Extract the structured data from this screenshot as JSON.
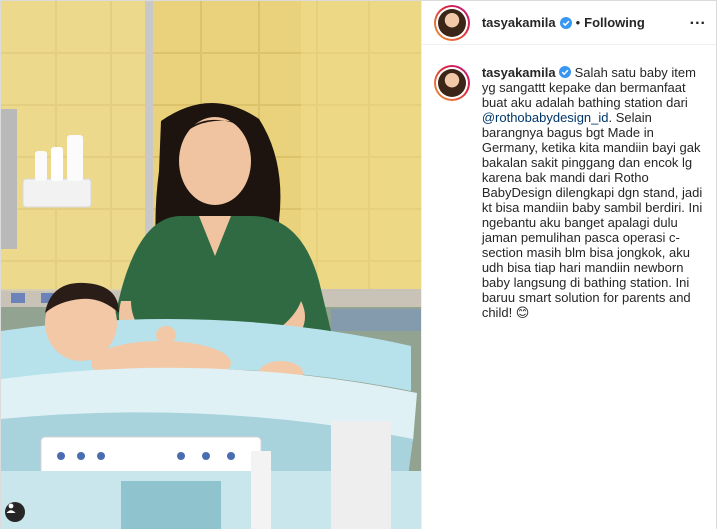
{
  "post": {
    "username": "tasyakamila",
    "follow_state": "Following",
    "separator": "•",
    "more_label": "...",
    "caption": {
      "username": "tasyakamila",
      "text_before": "Salah satu baby item yg sangattt kepake dan bermanfaat buat aku adalah bathing station dari ",
      "mention": "@rothobabydesign_id",
      "text_after": ". Selain barangnya bagus bgt Made in Germany, ketika kita mandiin bayi gak bakalan sakit pinggang dan encok lg karena bak mandi dari Rotho BabyDesign dilengkapi dgn stand, jadi kt bisa mandiin baby sambil berdiri. Ini ngebantu aku banget apalagi dulu jaman pemulihan pasca operasi c-section masih blm bisa jongkok, aku udh bisa tiap hari mandiin newborn baby langsung di bathing station. Ini baruu smart solution for parents and child! ",
      "emoji": "😊"
    }
  },
  "photo": {
    "description_icon": "user-tag-icon"
  },
  "colors": {
    "link": "#00376b",
    "verified": "#3897f0",
    "text": "#262626"
  }
}
